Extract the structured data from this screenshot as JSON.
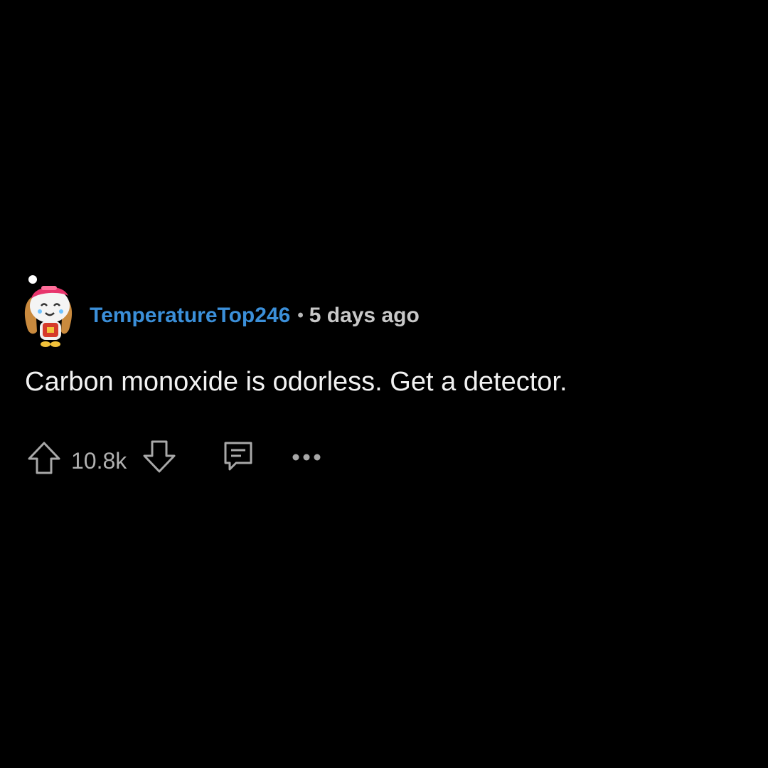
{
  "comment": {
    "author": "TemperatureTop246",
    "separator": "•",
    "timestamp": "5 days ago",
    "body": "Carbon monoxide is odorless. Get a detector.",
    "score": "10.8k"
  },
  "icons": {
    "avatar": "snoo-avatar",
    "upvote": "arrow-up-icon",
    "downvote": "arrow-down-icon",
    "reply": "comment-bubble-icon",
    "more": "ellipsis-icon"
  },
  "colors": {
    "background": "#000000",
    "username": "#3b8fd9",
    "text": "#f2f2f2",
    "muted": "#b0b0b0"
  }
}
